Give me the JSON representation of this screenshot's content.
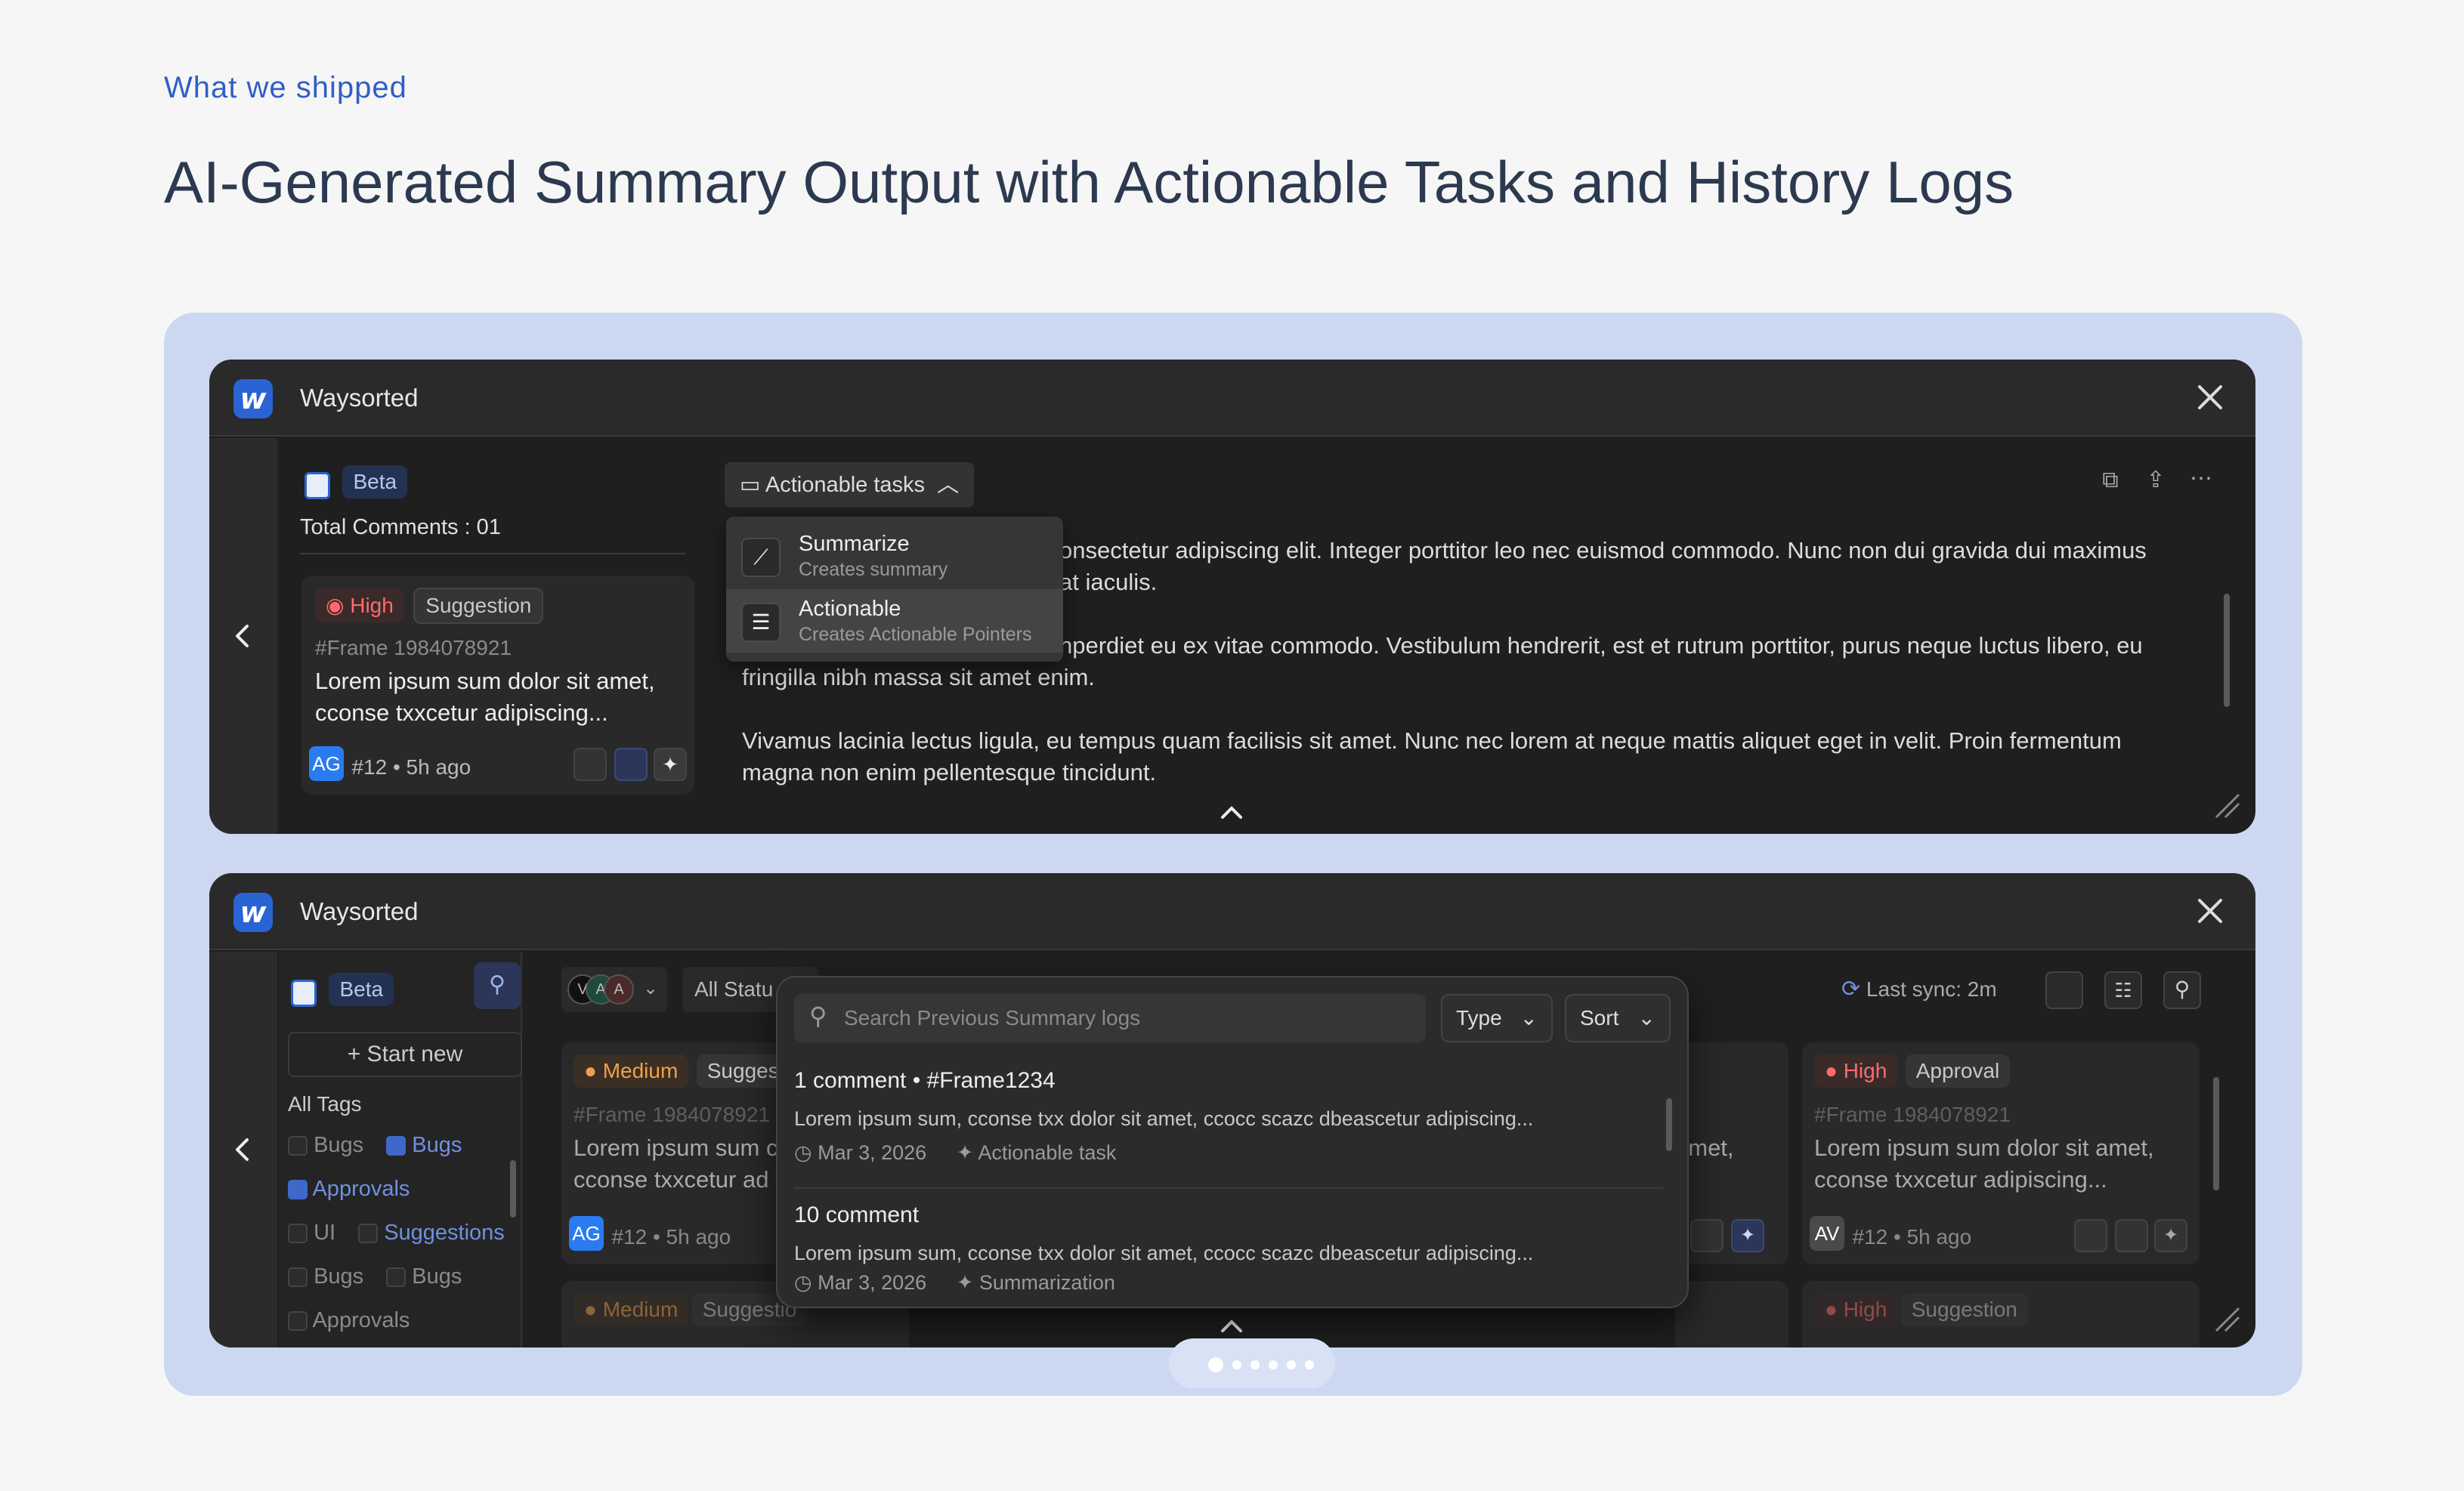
{
  "header": {
    "eyebrow": "What we shipped",
    "title": "AI-Generated Summary Output with Actionable Tasks and History Logs"
  },
  "colors": {
    "accent": "#2a63d4",
    "stage": "#ccd8f1",
    "high": "#ff6b6b",
    "medium": "#f0a048"
  },
  "window1": {
    "app_title": "Waysorted",
    "beta": "Beta",
    "total_comments": "Total Comments : 01",
    "card": {
      "priority": "High",
      "type": "Suggestion",
      "frame": "#Frame 1984078921",
      "text1": "Lorem ipsum sum dolor sit amet,",
      "text2": "cconse txxcetur adipiscing...",
      "avatar": "AG",
      "meta": "#12 • 5h ago"
    },
    "mode_button": "Actionable tasks",
    "dropdown": [
      {
        "title": "Summarize",
        "subtitle": "Creates summary",
        "icon": "wand-icon"
      },
      {
        "title": "Actionable",
        "subtitle": "Creates Actionable Pointers",
        "icon": "list-sparkle-icon"
      }
    ],
    "paragraphs": [
      {
        "l1": "onsectetur adipiscing elit. Integer porttitor leo nec euismod commodo. Nunc non dui gravida dui maximus",
        "l2": "at iaculis."
      },
      {
        "l1": "nperdiet eu ex vitae commodo. Vestibulum hendrerit, est et rutrum porttitor, purus neque luctus libero, eu",
        "l2": "fringilla nibh massa sit amet enim."
      },
      {
        "l1": "Vivamus lacinia lectus ligula, eu tempus quam facilisis sit amet. Nunc nec lorem at neque mattis aliquet eget in velit. Proin fermentum",
        "l2": "magna non enim pellentesque tincidunt."
      }
    ]
  },
  "window2": {
    "app_title": "Waysorted",
    "beta": "Beta",
    "start_new": "+ Start new",
    "all_tags": "All Tags",
    "tags": [
      {
        "a": "Bugs",
        "b": "Bugs",
        "b_checked": true,
        "a_checked": false
      },
      {
        "a": "Approvals",
        "a_checked": true,
        "b": ""
      },
      {
        "a": "UI",
        "a_checked": false,
        "b": "Suggestions",
        "b_checked": false
      },
      {
        "a": "Bugs",
        "a_checked": false,
        "b": "Bugs",
        "b_checked": false
      },
      {
        "a": "Approvals",
        "a_checked": false,
        "b": ""
      }
    ],
    "avatars": [
      "V",
      "A",
      "A"
    ],
    "status_filter": "All Statu",
    "last_sync": "Last sync: 2m",
    "left_card": {
      "priority": "Medium",
      "type": "Suggest",
      "frame": "#Frame 1984078921",
      "text1": "Lorem ipsum sum c",
      "text2": "cconse txxcetur ad",
      "avatar": "AG",
      "meta": "#12 • 5h ago",
      "next_priority": "Medium",
      "next_type": "Suggestio"
    },
    "middle_card_fragment": "amet,",
    "right_card": {
      "priority": "High",
      "type": "Approval",
      "frame": "#Frame 1984078921",
      "text1": "Lorem ipsum sum dolor sit amet,",
      "text2": "cconse txxcetur adipiscing...",
      "avatar": "AV",
      "meta": "#12 • 5h ago",
      "next_priority": "High",
      "next_type": "Suggestion"
    },
    "popup": {
      "search_placeholder": "Search Previous Summary logs",
      "type_label": "Type",
      "sort_label": "Sort",
      "logs": [
        {
          "title": "1 comment • #Frame1234",
          "text": "Lorem ipsum sum, cconse txx dolor sit amet, ccocc scazc dbeascetur adipiscing...",
          "date": "Mar 3, 2026",
          "kind": "Actionable task"
        },
        {
          "title": "10 comment",
          "text": "Lorem ipsum sum, cconse txx dolor sit amet, ccocc scazc dbeascetur adipiscing...",
          "date": "Mar 3, 2026",
          "kind": "Summarization"
        }
      ]
    }
  },
  "carousel": {
    "count": 6,
    "active": 0
  }
}
